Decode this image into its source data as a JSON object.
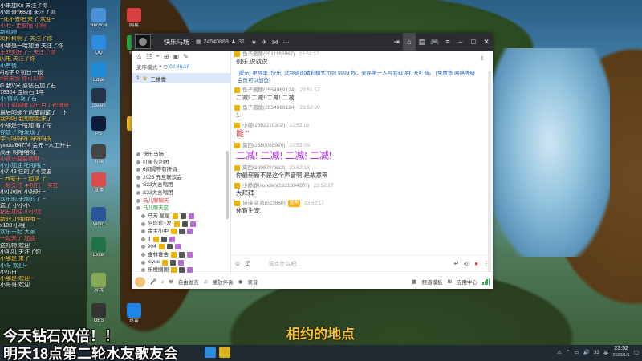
{
  "danmaku": [
    "小来加Ko  关注了你",
    "小哥哥快82g 关注了你",
    "~死不去吧 来了 欢迎~",
    "小七~ 走前呢 小啊",
    "新礼物",
    "鸡科科啊了  关注了你",
    "小哪是一哈加鱼 关注了你",
    "王的刘好了~ 关注了你",
    "  闪电 关注了你",
    "小有情",
    "#同学 0 初日一段",
    "#来来到 你可以的",
    "G 我V米  原钻石加了石",
    "78304 连续石 1年",
    "小 情调  发了石",
    "小丁调调哦 以往月了初道道",
    "最后的那个调整调整了一下",
    "我的吧 我想想起来了",
    "小哪是一哈加 看了哈",
    "你放了  哈发现了",
    "学习呀呀呀  呀呀呀呀",
    "yindu/84774  会先 ~人工升手",
    "高手 呀哈哈呀",
    "小孩子要要请嘛 ~",
    "小小加油  吧哦哦 ~",
    "小7 43  住的了不变要",
    "~ 西安王 ~ 如是 了",
    "一起关注  手机打 ~ 实在",
    "小小同同  小好好 ~",
    "欢乐的  无聊的了 ~",
    "送了 小小小  ~",
    "钻石加油 小小加",
    "新的 小哦哦哦  ~",
    "x100  小哦",
    "欢乐一起 大家",
    "一起来了  加油",
    "送礼物  欢迎",
    "小叽叽 关注了你",
    "小哪是 来了",
    "小呀 欢迎~",
    "小小白",
    "小哪是  欢迎~",
    "小哥哥 欢迎"
  ],
  "desktop_icons": [
    {
      "label": "Recycle",
      "color": "#4a90d9"
    },
    {
      "label": "网易",
      "color": "#d84040"
    },
    {
      "label": "QQ",
      "color": "#2a8be0"
    },
    {
      "label": "微信",
      "color": "#2bb24c"
    },
    {
      "label": "Edge",
      "color": "#1c8ad6"
    },
    {
      "label": "Steam",
      "color": "#233446"
    },
    {
      "label": "PS",
      "color": "#0f1a3a"
    },
    {
      "label": "YY",
      "color": "#f0c020"
    },
    {
      "label": "剪辑",
      "color": "#444"
    },
    {
      "label": "直播",
      "color": "#d84c4c"
    },
    {
      "label": "Word",
      "color": "#2b579a"
    },
    {
      "label": "Excel",
      "color": "#217346"
    },
    {
      "label": "游戏",
      "color": "#8a5"
    },
    {
      "label": "OBS",
      "color": "#333"
    },
    {
      "label": "迅雷",
      "color": "#1f86e8"
    }
  ],
  "window": {
    "room_name": "快乐马场",
    "room_id": "24540869",
    "online_count": "31",
    "mode_label": "麦序模式",
    "mode_time": "02:46:16",
    "channel_name": "三楼壹",
    "channel_count": "1"
  },
  "tree": [
    {
      "text": "快乐马场",
      "kind": "head"
    },
    {
      "text": "红星永利团",
      "kind": "node"
    },
    {
      "text": "6间隔等有所情",
      "kind": "node"
    },
    {
      "text": "2023 元旦联欢会",
      "kind": "node"
    },
    {
      "text": "S23大合唱团",
      "kind": "node"
    },
    {
      "text": "S23大合唱团",
      "kind": "node"
    },
    {
      "text": "马儿聊聊天",
      "kind": "red"
    },
    {
      "text": "马儿聊天区",
      "kind": "green"
    },
    {
      "text": "马芳 星星",
      "kind": "sub"
    },
    {
      "text": "阿珍珍~发",
      "kind": "sub"
    },
    {
      "text": "金主小中",
      "kind": "sub"
    },
    {
      "text": "II",
      "kind": "sub"
    },
    {
      "text": "994",
      "kind": "sub"
    },
    {
      "text": "金林谁会",
      "kind": "sub"
    },
    {
      "text": "xiyue",
      "kind": "sub"
    },
    {
      "text": "乐橙圈圈",
      "kind": "sub"
    }
  ],
  "notice": "[提示]  更频率 [快乐] 此频道的精彩模式拉到 9999 秒，麦序第一人可到延误打开扩音。 [免费鱼 网络等级会员可以加鱼]",
  "messages": [
    {
      "user": "鱼子酱酸(2511163967)",
      "time": "23:51:27",
      "text": "别乐,说就说",
      "style": ""
    },
    {
      "user": "鱼子酱酸(2554969124)",
      "time": "23:51:57",
      "text": "二减! 二减! 二减! 二减!",
      "style": ""
    },
    {
      "user": "鱼子酱酸(2554969124)",
      "time": "23:52:00",
      "text": "1",
      "style": ""
    },
    {
      "user": "小周(1502220302)",
      "time": "23:52:01",
      "text": "能 '' ",
      "style": "red"
    },
    {
      "user": "莫困(2580085970)",
      "time": "23:52:05",
      "text": "二减! 二减! 二减! 二减!",
      "style": "purple"
    },
    {
      "user": "莫困(2408784813)",
      "time": "23:52:13",
      "text": "你最崭新不是这个声音啊 是故意带",
      "style": ""
    },
    {
      "user": "小静静(sundie)(2621694207)",
      "time": "23:52:17",
      "text": "大拜拜",
      "style": ""
    },
    {
      "user": "诗漫 蓝蓝(523860)",
      "time": "23:52:17",
      "text": "休育生宠",
      "style": "",
      "level": "盛典"
    }
  ],
  "input": {
    "placeholder": "说点什么吧..."
  },
  "bottom": {
    "speaker_label": "自由发言",
    "play_label": "播放伴奏",
    "record_label": "录音",
    "board_label": "频道模板",
    "app_label": "应用中心"
  },
  "overlay": {
    "lyric": "相约的地点",
    "ticker1": "今天钻石双倍！！",
    "ticker2": "明天18点第二轮水友歌友会"
  },
  "taskbar": {
    "time": "23:52",
    "date": "2023/1/1",
    "lang": "英",
    "volume": "33"
  },
  "colors": {
    "titlebar": "#2c2d31",
    "accent": "#2a7be4",
    "purple_msg": "#b12de0",
    "red_msg": "#ee3333"
  }
}
